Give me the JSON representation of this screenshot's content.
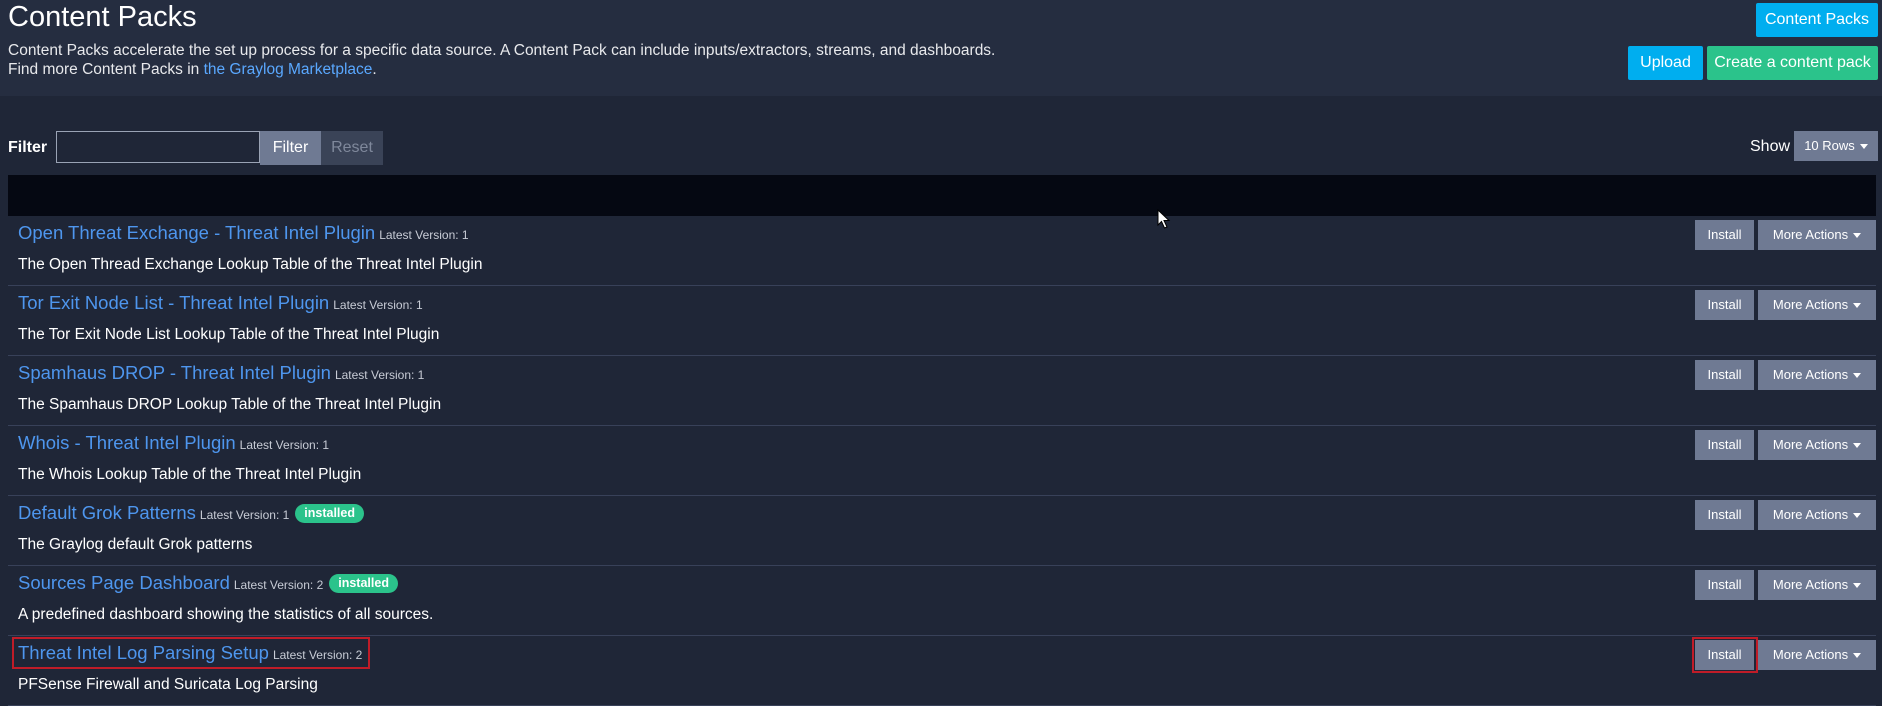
{
  "header": {
    "title": "Content Packs",
    "description_line1": "Content Packs accelerate the set up process for a specific data source. A Content Pack can include inputs/extractors, streams, and dashboards.",
    "description_line2_prefix": "Find more Content Packs in ",
    "marketplace_link": "the Graylog Marketplace",
    "description_line2_suffix": ".",
    "content_packs_button": "Content Packs",
    "upload_button": "Upload",
    "create_button": "Create a content pack"
  },
  "filter": {
    "label": "Filter",
    "input_value": "",
    "filter_button": "Filter",
    "reset_button": "Reset",
    "show_label": "Show",
    "rows_option": "10 Rows"
  },
  "packs": [
    {
      "name": "Open Threat Exchange - Threat Intel Plugin",
      "version_label": "Latest Version: 1",
      "installed": "",
      "description": "The Open Thread Exchange Lookup Table of the Threat Intel Plugin",
      "install_label": "Install",
      "more_actions_label": "More Actions"
    },
    {
      "name": "Tor Exit Node List - Threat Intel Plugin",
      "version_label": "Latest Version: 1",
      "installed": "",
      "description": "The Tor Exit Node List Lookup Table of the Threat Intel Plugin",
      "install_label": "Install",
      "more_actions_label": "More Actions"
    },
    {
      "name": "Spamhaus DROP - Threat Intel Plugin",
      "version_label": "Latest Version: 1",
      "installed": "",
      "description": "The Spamhaus DROP Lookup Table of the Threat Intel Plugin",
      "install_label": "Install",
      "more_actions_label": "More Actions"
    },
    {
      "name": "Whois - Threat Intel Plugin",
      "version_label": "Latest Version: 1",
      "installed": "",
      "description": "The Whois Lookup Table of the Threat Intel Plugin",
      "install_label": "Install",
      "more_actions_label": "More Actions"
    },
    {
      "name": "Default Grok Patterns",
      "version_label": "Latest Version: 1",
      "installed": "installed",
      "description": "The Graylog default Grok patterns",
      "install_label": "Install",
      "more_actions_label": "More Actions"
    },
    {
      "name": "Sources Page Dashboard",
      "version_label": "Latest Version: 2",
      "installed": "installed",
      "description": "A predefined dashboard showing the statistics of all sources.",
      "install_label": "Install",
      "more_actions_label": "More Actions"
    },
    {
      "name": "Threat Intel Log Parsing Setup",
      "version_label": "Latest Version: 2",
      "installed": "",
      "description": "PFSense Firewall and Suricata Log Parsing",
      "install_label": "Install",
      "more_actions_label": "More Actions"
    }
  ],
  "colors": {
    "background": "#1f2637",
    "link": "#4e96ee",
    "accent_cyan": "#00aeef",
    "accent_green": "#2bc38b",
    "highlight_red": "#c01c28"
  }
}
